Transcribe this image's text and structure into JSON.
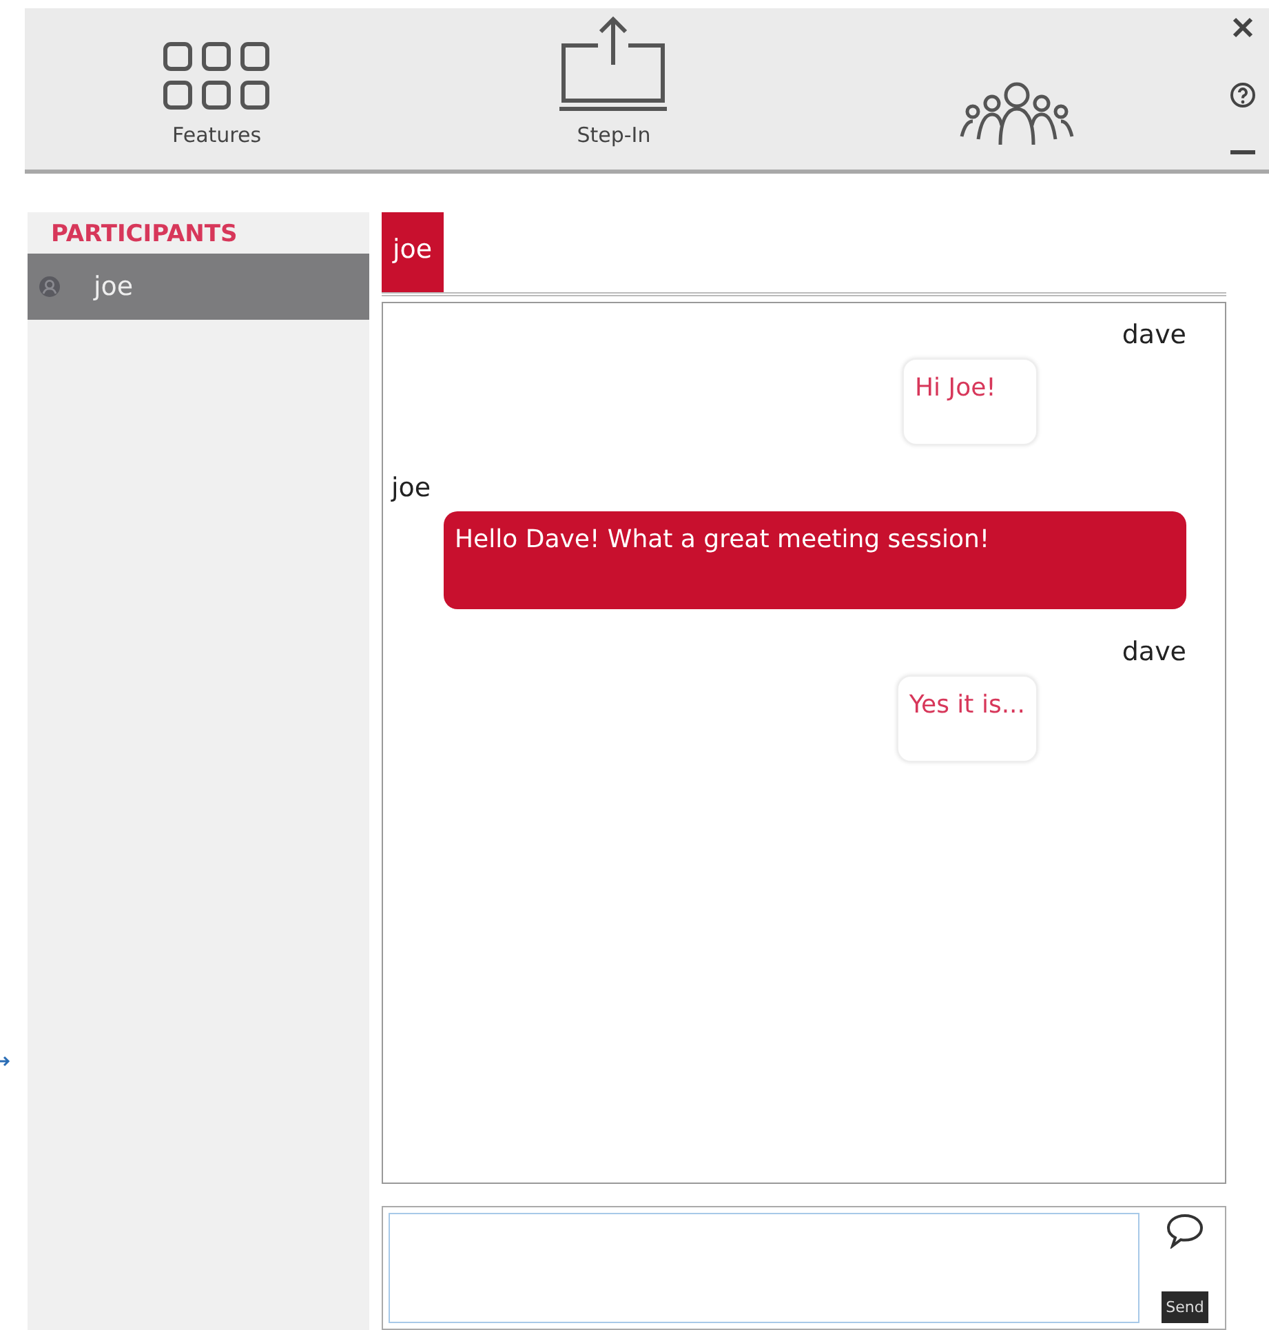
{
  "toolbar": {
    "items": [
      {
        "kind": "grid",
        "label": "Features"
      },
      {
        "kind": "upload",
        "label": "Step-In"
      },
      {
        "kind": "people"
      }
    ],
    "window_controls": [
      {
        "kind": "close"
      },
      {
        "kind": "help"
      },
      {
        "kind": "minimize"
      }
    ]
  },
  "sidebar": {
    "title": "PARTICIPANTS",
    "items": [
      {
        "name": "joe",
        "selected": true
      }
    ]
  },
  "chat_tabs": [
    {
      "label": "joe",
      "selected": true
    }
  ],
  "messages": [
    {
      "sender": "dave",
      "kind": "self",
      "text": "Hi Joe!"
    },
    {
      "sender": "joe",
      "kind": "other",
      "text": "Hello Dave! What a great meeting session!"
    },
    {
      "sender": "dave",
      "kind": "self",
      "text": "Yes it is..."
    }
  ],
  "composer": {
    "send_label": "Send"
  }
}
